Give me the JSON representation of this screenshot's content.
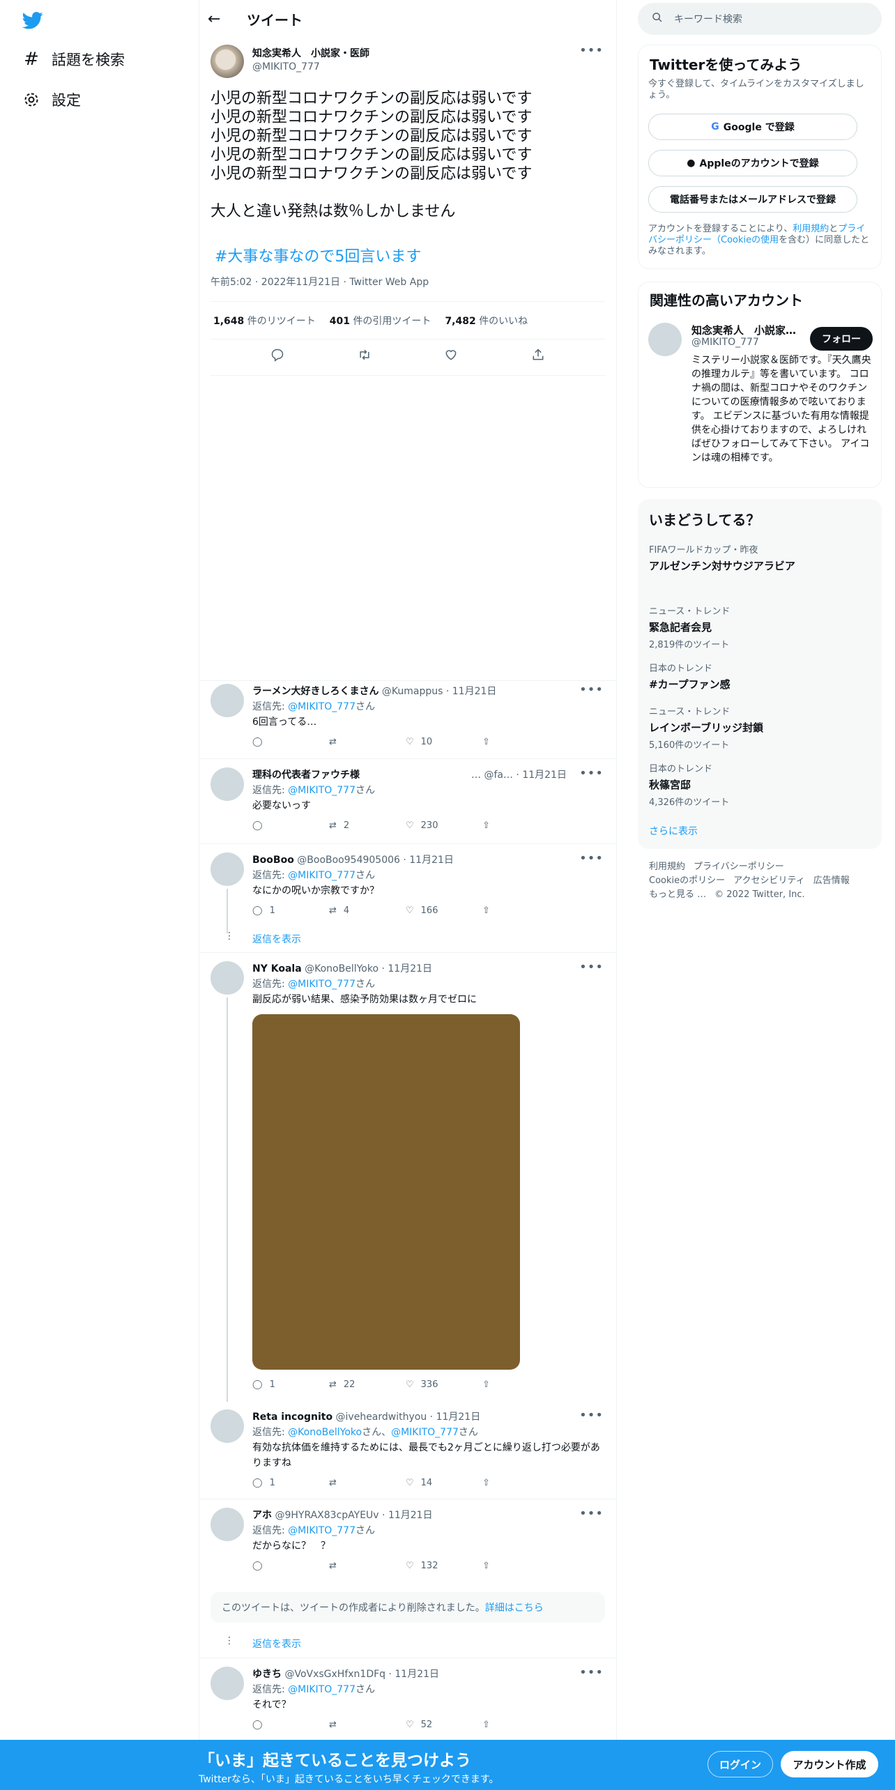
{
  "nav": {
    "explore_label": "話題を検索",
    "settings_label": "設定"
  },
  "header": {
    "title": "ツイート"
  },
  "main_tweet": {
    "name": "知念実希人　小説家・医師",
    "handle": "@MIKITO_777",
    "lines": [
      "小児の新型コロナワクチンの副反応は弱いです",
      "小児の新型コロナワクチンの副反応は弱いです",
      "小児の新型コロナワクチンの副反応は弱いです",
      "小児の新型コロナワクチンの副反応は弱いです",
      "小児の新型コロナワクチンの副反応は弱いです",
      "",
      "大人と違い発熱は数％しかしません"
    ],
    "hashtag": "#大事な事なので5回言います",
    "meta": "午前5:02 · 2022年11月21日 · Twitter Web App",
    "retweets_count": "1,648",
    "retweets_label": "件のリツイート",
    "quotes_count": "401",
    "quotes_label": "件の引用ツイート",
    "likes_count": "7,482",
    "likes_label": "件のいいね"
  },
  "replies": [
    {
      "name": "ラーメン大好きしろくまさん",
      "handle": "@Kumappus",
      "date": "· 11月21日",
      "to_prefix": "返信先:",
      "to": "@MIKITO_777",
      "to_suffix": "さん",
      "text": "6回言ってる…",
      "replies": "",
      "retweets": "",
      "likes": "10"
    },
    {
      "name": "理科の代表者ファウチ様",
      "handle": "… @fa…",
      "date": "· 11月21日",
      "to_prefix": "返信先:",
      "to": "@MIKITO_777",
      "to_suffix": "さん",
      "text": "必要ないっす",
      "replies": "",
      "retweets": "2",
      "likes": "230"
    },
    {
      "name": "BooBoo",
      "handle": "@BooBoo954905006",
      "date": "· 11月21日",
      "to_prefix": "返信先:",
      "to": "@MIKITO_777",
      "to_suffix": "さん",
      "text": "なにかの呪いか宗教ですか？",
      "replies": "1",
      "retweets": "4",
      "likes": "166",
      "show_replies": "返信を表示"
    },
    {
      "name": "NY Koala",
      "handle": "@KonoBellYoko",
      "date": "· 11月21日",
      "to_prefix": "返信先:",
      "to": "@MIKITO_777",
      "to_suffix": "さん",
      "text": "副反応が弱い結果、感染予防効果は数ヶ月でゼロに",
      "replies": "1",
      "retweets": "22",
      "likes": "336"
    },
    {
      "name": "Reta incognito",
      "handle": "@iveheardwithyou",
      "date": "· 11月21日",
      "to_prefix": "返信先:",
      "to": "@KonoBellYoko",
      "to_mid": "さん、",
      "to2": "@MIKITO_777",
      "to_suffix": "さん",
      "text": "有効な抗体価を維持するためには、最長でも2ヶ月ごとに繰り返し打つ必要がありますね",
      "replies": "1",
      "retweets": "",
      "likes": "14"
    },
    {
      "name": "アホ",
      "handle": "@9HYRAX83cpAYEUv",
      "date": "· 11月21日",
      "to_prefix": "返信先:",
      "to": "@MIKITO_777",
      "to_suffix": "さん",
      "text": "だからなに？　？",
      "replies": "",
      "retweets": "",
      "likes": "132"
    },
    {
      "name": "ゆきち",
      "handle": "@VoVxsGxHfxn1DFq",
      "date": "· 11月21日",
      "to_prefix": "返信先:",
      "to": "@MIKITO_777",
      "to_suffix": "さん",
      "text": "それで？",
      "replies": "",
      "retweets": "",
      "likes": "52"
    }
  ],
  "deleted": {
    "text": "このツイートは、ツイートの作成者により削除されました。",
    "link": "詳細はこちら",
    "show_replies": "返信を表示"
  },
  "sidebar": {
    "search_placeholder": "キーワード検索",
    "signup": {
      "title": "Twitterを使ってみよう",
      "subtitle": "今すぐ登録して、タイムラインをカスタマイズしましょう。",
      "google": "Google で登録",
      "apple": "Appleのアカウントで登録",
      "phone": "電話番号またはメールアドレスで登録",
      "terms_prefix": "アカウントを登録することにより、",
      "terms_link1": "利用規約",
      "terms_mid1": "と",
      "terms_link2": "プライバシーポリシー",
      "terms_link3": "（Cookieの使用",
      "terms_suffix": "を含む）に同意したとみなされます。"
    },
    "related": {
      "title": "関連性の高いアカウント",
      "name": "知念実希人　小説家…",
      "handle": "@MIKITO_777",
      "follow": "フォロー",
      "bio": "ミステリー小説家＆医師です。『天久鷹央の推理カルテ』等を書いています。 コロナ禍の間は、新型コロナやそのワクチンについての医療情報多めで呟いております。 エビデンスに基づいた有用な情報提供を心掛けておりますので、よろしければぜひフォローしてみて下さい。 アイコンは魂の相棒です。"
    },
    "trends": {
      "title": "いまどうしてる？",
      "items": [
        {
          "category": "FIFAワールドカップ・昨夜",
          "title": "アルゼンチン対サウジアラビア",
          "count": ""
        },
        {
          "category": "ニュース・トレンド",
          "title": "緊急記者会見",
          "count": "2,819件のツイート"
        },
        {
          "category": "日本のトレンド",
          "title": "#カープファン感",
          "count": ""
        },
        {
          "category": "ニュース・トレンド",
          "title": "レインボーブリッジ封鎖",
          "count": "5,160件のツイート"
        },
        {
          "category": "日本のトレンド",
          "title": "秋篠宮邸",
          "count": "4,326件のツイート"
        }
      ],
      "more": "さらに表示"
    },
    "footer": {
      "terms": "利用規約",
      "privacy": "プライバシーポリシー",
      "cookie": "Cookieのポリシー",
      "accessibility": "アクセシビリティ",
      "ads": "広告情報",
      "more": "もっと見る …",
      "copyright": "© 2022 Twitter, Inc."
    }
  },
  "bottom_bar": {
    "headline": "「いま」起きていることを見つけよう",
    "sub": "Twitterなら、「いま」起きていることをいち早くチェックできます。",
    "login": "ログイン",
    "signup": "アカウント作成"
  },
  "colors": {
    "accent": "#1d9bf0",
    "text": "#0f1419",
    "muted": "#536471",
    "media": "#7d5f2e"
  }
}
